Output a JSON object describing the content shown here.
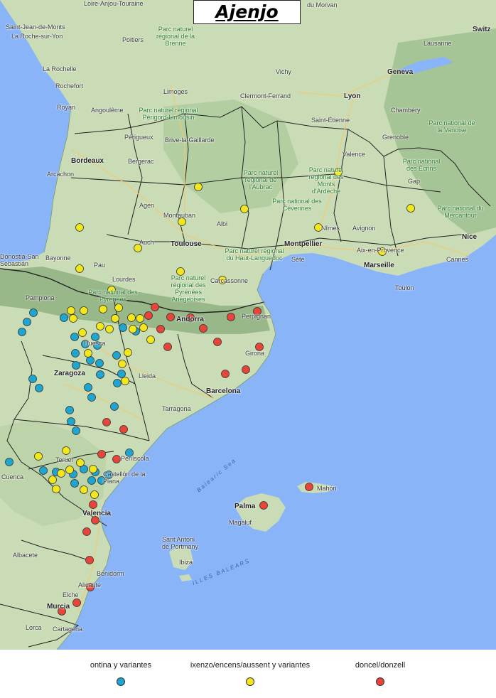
{
  "title": "Ajenjo",
  "legend": [
    {
      "label": "ontina y variantes",
      "color": "#1ea6d1"
    },
    {
      "label": "ixenzo/encens/aussent y  variantes",
      "color": "#f2e71c"
    },
    {
      "label": "doncel/donzell",
      "color": "#e8443a"
    }
  ],
  "colors": {
    "sea": "#8ab4f8",
    "land": "#c9dcb5",
    "mountain": "#9dbf8f",
    "border": "#222222"
  },
  "places": {
    "loire": "Loire-Anjou-Touraine",
    "stjean": "Saint-Jean-de-Monts",
    "laroche": "La Roche-sur-Yon",
    "poitiers": "Poitiers",
    "brenne": "Parc naturel régional de la Brenne",
    "morvan": "du Morvan",
    "suiza": "Switz",
    "larochelle": "La Rochelle",
    "rochefort": "Rochefort",
    "royan": "Royan",
    "angouleme": "Angoulême",
    "limoges": "Limoges",
    "vichy": "Vichy",
    "clermont": "Clermont-Ferrand",
    "lyon": "Lyon",
    "geneva": "Geneva",
    "lausanne": "Lausanne",
    "chambery": "Chambéry",
    "stetienne": "Saint-Étienne",
    "perigord": "Parc naturel régional Périgord-Limousin",
    "perigueux": "Périgueux",
    "brive": "Brive-la-Gaillarde",
    "vanoise": "Parc national de la Vanoise",
    "grenoble": "Grenoble",
    "bordeaux": "Bordeaux",
    "arcachon": "Arcachon",
    "bergerac": "Bergerac",
    "valence": "Valence",
    "aubrac": "Parc naturel régional de l'Aubrac",
    "ardeche": "Parc naturel régional des Monts d'Ardèche",
    "ecrins": "Parc national des Écrins",
    "gap": "Gap",
    "agen": "Agen",
    "montauban": "Montauban",
    "albi": "Albi",
    "cevennes": "Parc national des Cévennes",
    "mercantour": "Parc national du Mercantour",
    "auch": "Auch",
    "toulouse": "Toulouse",
    "nimes": "Nîmes",
    "avignon": "Avignon",
    "nice": "Nice",
    "montpellier": "Montpellier",
    "hautlanguedoc": "Parc naturel régional du Haut-Languedoc",
    "aix": "Aix-en-Provence",
    "cannes": "Cannes",
    "donostia": "Donostia-San Sebastián",
    "bayonne": "Bayonne",
    "pau": "Pau",
    "lourdes": "Lourdes",
    "sete": "Sète",
    "marseille": "Marseille",
    "toulon": "Toulon",
    "carcassonne": "Carcassonne",
    "pyrenees": "Parc national des Pyrénées",
    "ariegeoises": "Parc naturel régional des Pyrénées Ariégeoises",
    "pamplona": "Pamplona",
    "andorra": "Andorra",
    "perpignan": "Perpignan",
    "huesca": "Huesca",
    "girona": "Girona",
    "zaragoza": "Zaragoza",
    "lleida": "Lleida",
    "barcelona": "Barcelona",
    "tarragona": "Tarragona",
    "peniscola": "Peníscola",
    "teruel": "Teruel",
    "castellon": "Castellón de la Plana",
    "cuenca": "Cuenca",
    "balearicsea": "Balearic Sea",
    "mahon": "Mahón",
    "palma": "Palma",
    "magaluf": "Magaluf",
    "valencia": "Valencia",
    "santantoni": "Sant Antoni de Portmany",
    "ibiza": "Ibiza",
    "illesbalears": "ILLES BALEARS",
    "albacete": "Albacete",
    "benidorm": "Benidorm",
    "alicante": "Alicante",
    "elche": "Elche",
    "murcia": "Murcia",
    "lorca": "Lorca",
    "cartagena": "Cartagena"
  },
  "points": {
    "ontina": [
      [
        47,
        440
      ],
      [
        38,
        453
      ],
      [
        31,
        467
      ],
      [
        90,
        447
      ],
      [
        105,
        474
      ],
      [
        120,
        484
      ],
      [
        134,
        474
      ],
      [
        137,
        486
      ],
      [
        173,
        461
      ],
      [
        191,
        466
      ],
      [
        106,
        497
      ],
      [
        127,
        507
      ],
      [
        140,
        511
      ],
      [
        164,
        500
      ],
      [
        171,
        526
      ],
      [
        107,
        514
      ],
      [
        141,
        527
      ],
      [
        46,
        533
      ],
      [
        55,
        546
      ],
      [
        124,
        545
      ],
      [
        129,
        559
      ],
      [
        165,
        539
      ],
      [
        161,
        572
      ],
      [
        98,
        577
      ],
      [
        100,
        593
      ],
      [
        107,
        606
      ],
      [
        13,
        650
      ],
      [
        61,
        662
      ],
      [
        79,
        664
      ],
      [
        103,
        667
      ],
      [
        118,
        660
      ],
      [
        134,
        664
      ],
      [
        129,
        676
      ],
      [
        143,
        676
      ],
      [
        105,
        680
      ],
      [
        153,
        668
      ],
      [
        182,
        637
      ]
    ],
    "ixenzo": [
      [
        476,
        242
      ],
      [
        279,
        263
      ],
      [
        344,
        294
      ],
      [
        578,
        293
      ],
      [
        112,
        320
      ],
      [
        256,
        312
      ],
      [
        448,
        320
      ],
      [
        194,
        349
      ],
      [
        538,
        354
      ],
      [
        112,
        378
      ],
      [
        254,
        382
      ],
      [
        313,
        394
      ],
      [
        157,
        408
      ],
      [
        100,
        437
      ],
      [
        118,
        437
      ],
      [
        145,
        435
      ],
      [
        167,
        433
      ],
      [
        103,
        448
      ],
      [
        162,
        448
      ],
      [
        185,
        447
      ],
      [
        197,
        448
      ],
      [
        141,
        459
      ],
      [
        154,
        463
      ],
      [
        187,
        463
      ],
      [
        202,
        461
      ],
      [
        116,
        468
      ],
      [
        212,
        478
      ],
      [
        124,
        497
      ],
      [
        180,
        496
      ],
      [
        172,
        512
      ],
      [
        176,
        536
      ],
      [
        54,
        642
      ],
      [
        93,
        634
      ],
      [
        74,
        675
      ],
      [
        79,
        688
      ],
      [
        86,
        666
      ],
      [
        98,
        661
      ],
      [
        113,
        651
      ],
      [
        131,
        660
      ],
      [
        118,
        689
      ],
      [
        133,
        696
      ]
    ],
    "doncel": [
      [
        218,
        432
      ],
      [
        209,
        444
      ],
      [
        240,
        446
      ],
      [
        268,
        447
      ],
      [
        325,
        446
      ],
      [
        362,
        438
      ],
      [
        226,
        463
      ],
      [
        286,
        462
      ],
      [
        236,
        488
      ],
      [
        306,
        481
      ],
      [
        365,
        488
      ],
      [
        346,
        520
      ],
      [
        317,
        526
      ],
      [
        150,
        594
      ],
      [
        174,
        604
      ],
      [
        143,
        639
      ],
      [
        164,
        646
      ],
      [
        435,
        685
      ],
      [
        371,
        711
      ],
      [
        131,
        710
      ],
      [
        134,
        732
      ],
      [
        122,
        748
      ],
      [
        126,
        788
      ],
      [
        127,
        826
      ],
      [
        108,
        848
      ],
      [
        87,
        860
      ]
    ]
  }
}
